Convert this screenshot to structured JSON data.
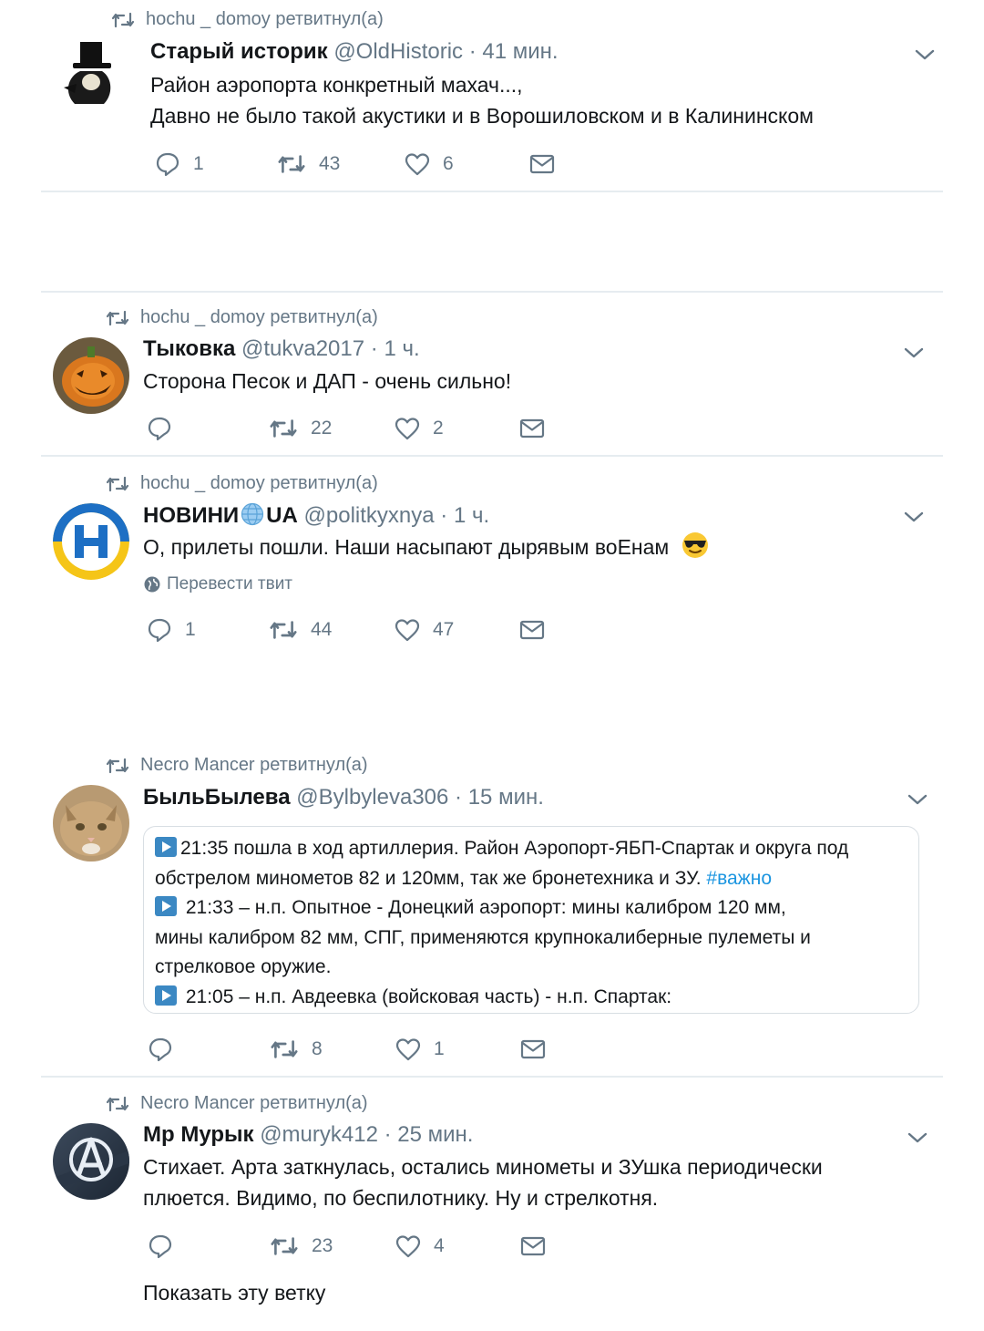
{
  "tweets": [
    {
      "retweeter": "hochu _ domoy ретвитнул(а)",
      "name": "Старый историк",
      "handle": "@OldHistoric",
      "sep": "·",
      "time": "41 мин.",
      "lines": [
        "Район аэропорта конкретный махач...,",
        "Давно не было такой акустики и в Ворошиловском и в Калининском"
      ],
      "reply_count": "1",
      "retweet_count": "43",
      "like_count": "6"
    },
    {
      "retweeter": "hochu _ domoy ретвитнул(а)",
      "name": "Тыковка",
      "handle": "@tukva2017",
      "sep": "·",
      "time": "1 ч.",
      "lines": [
        "Сторона Песок и ДАП - очень сильно!"
      ],
      "reply_count": "",
      "retweet_count": "22",
      "like_count": "2"
    },
    {
      "retweeter": "hochu _ domoy ретвитнул(а)",
      "name_a": "НОВИНИ",
      "name_b": "UA",
      "handle": "@politkyxnya",
      "sep": "·",
      "time": "1 ч.",
      "lines": [
        "О, прилеты пошли. Наши насыпают дырявым воЕнам"
      ],
      "translate": "Перевести твит",
      "reply_count": "1",
      "retweet_count": "44",
      "like_count": "47"
    },
    {
      "retweeter": "Necro Mancer ретвитнул(а)",
      "name": "БыльБылева",
      "handle": "@Bylbyleva306",
      "sep": "·",
      "time": "15 мин.",
      "quote": {
        "l1": "21:35 пошла в ход артиллерия. Район Аэропорт-ЯБП-Спартак и округа под",
        "l2": "обстрелом минометов 82 и 120мм, так же бронетехника и ЗУ.",
        "hashtag": "#важно",
        "l3": " 21:33 – н.п. Опытное - Донецкий аэропорт:  мины калибром 120 мм,",
        "l4": "мины калибром 82 мм,  СПГ, применяются  крупнокалиберные пулеметы и",
        "l5": "стрелковое оружие.",
        "l6": " 21:05 – н.п. Авдеевка (войсковая часть) - н.п. Спартак:"
      },
      "reply_count": "",
      "retweet_count": "8",
      "like_count": "1"
    },
    {
      "retweeter": "Necro Mancer ретвитнул(а)",
      "name": "Мр Мурык",
      "handle": "@muryk412",
      "sep": "·",
      "time": "25 мин.",
      "lines": [
        "Стихает. Арта заткнулась, остались минометы и ЗУшка периодически",
        "плюется. Видимо, по беспилотнику. Ну и стрелкотня."
      ],
      "reply_count": "",
      "retweet_count": "23",
      "like_count": "4"
    }
  ],
  "show_thread": "Показать эту ветку",
  "colors": {
    "text": "#14171a",
    "muted": "#657786",
    "link": "#1b95e0",
    "divider": "#e6ecf0"
  },
  "icons": [
    "retweet-icon",
    "reply-icon",
    "like-icon",
    "message-icon",
    "chevron-down-icon",
    "globe-icon",
    "play-icon",
    "sunglasses-emoji-icon"
  ]
}
